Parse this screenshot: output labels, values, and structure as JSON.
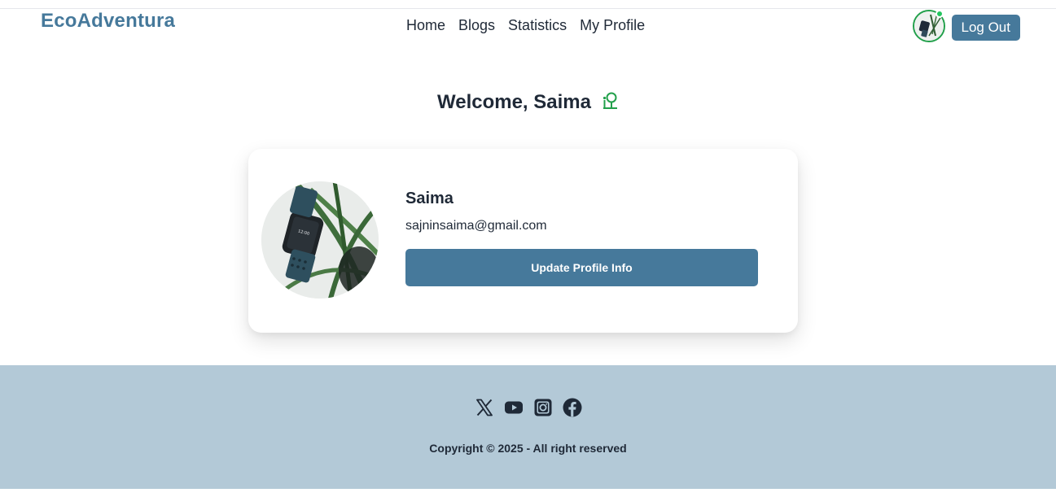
{
  "header": {
    "brand": "EcoAdventura",
    "nav": [
      {
        "label": "Home"
      },
      {
        "label": "Blogs"
      },
      {
        "label": "Statistics"
      },
      {
        "label": "My Profile"
      }
    ],
    "logout_label": "Log Out"
  },
  "welcome": {
    "text": "Welcome, Saima",
    "icon": "tree-person-icon"
  },
  "profile": {
    "name": "Saima",
    "email": "sajninsaima@gmail.com",
    "update_label": "Update Profile Info"
  },
  "footer": {
    "social_icons": [
      "x-icon",
      "youtube-icon",
      "instagram-icon",
      "facebook-icon"
    ],
    "copyright": "Copyright © 2025 - All right reserved"
  },
  "colors": {
    "brand": "#46799b",
    "footer_bg": "#b3c9d7",
    "online": "#22c55e",
    "accent_green": "#22a04b"
  }
}
